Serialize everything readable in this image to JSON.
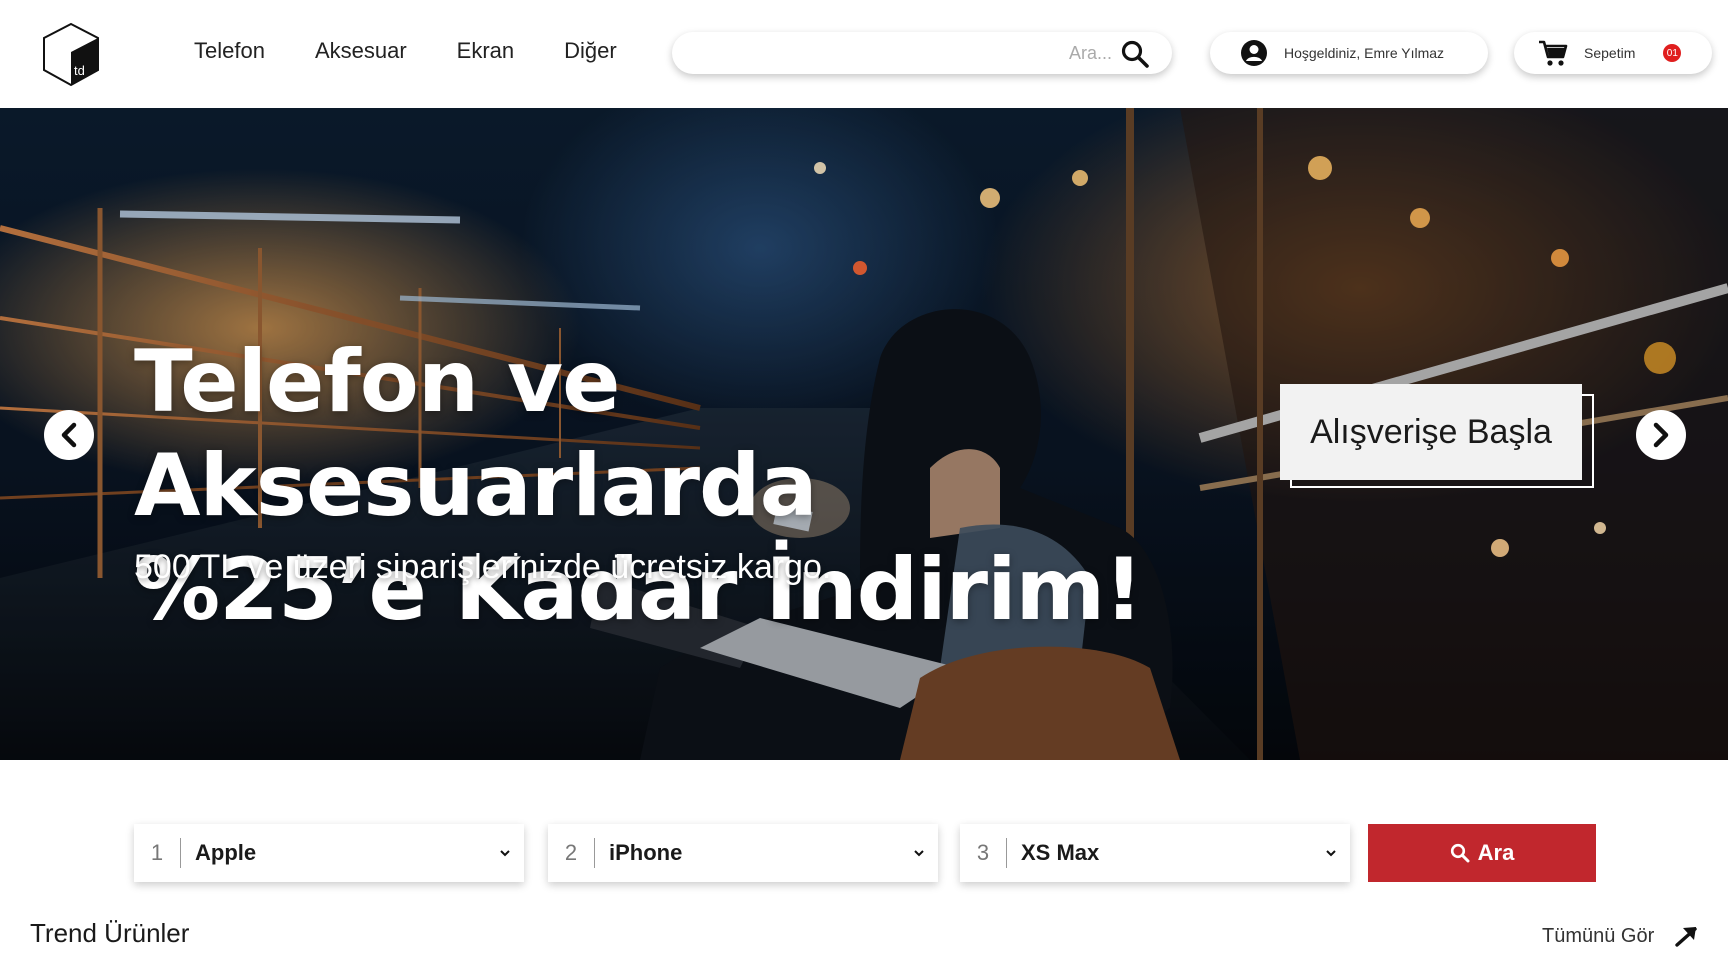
{
  "header": {
    "logo_text": "td",
    "nav": [
      "Telefon",
      "Aksesuar",
      "Ekran",
      "Diğer"
    ],
    "search_placeholder": "Ara...",
    "user_greeting": "Hoşgeldiniz, Emre Yılmaz",
    "cart_label": "Sepetim",
    "cart_count": "01"
  },
  "hero": {
    "title_line1": "Telefon ve Aksesuarlarda",
    "title_line2": "%25’e Kadar İndirim!",
    "subtitle": "500 TL ve üzeri siparişlerinizde ücretsiz kargo.",
    "cta_label": "Alışverişe Başla"
  },
  "filters": [
    {
      "num": "1",
      "value": "Apple"
    },
    {
      "num": "2",
      "value": "iPhone"
    },
    {
      "num": "3",
      "value": "XS Max"
    }
  ],
  "search_button": "Ara",
  "trend": {
    "title": "Trend Ürünler",
    "see_all": "Tümünü Gör"
  },
  "colors": {
    "accent": "#c1272d",
    "badge": "#e01e1e"
  },
  "icons": [
    "logo-cube-icon",
    "search-icon",
    "user-icon",
    "cart-icon",
    "chevron-left-icon",
    "chevron-right-icon",
    "chevron-down-icon",
    "arrow-up-right-icon"
  ]
}
